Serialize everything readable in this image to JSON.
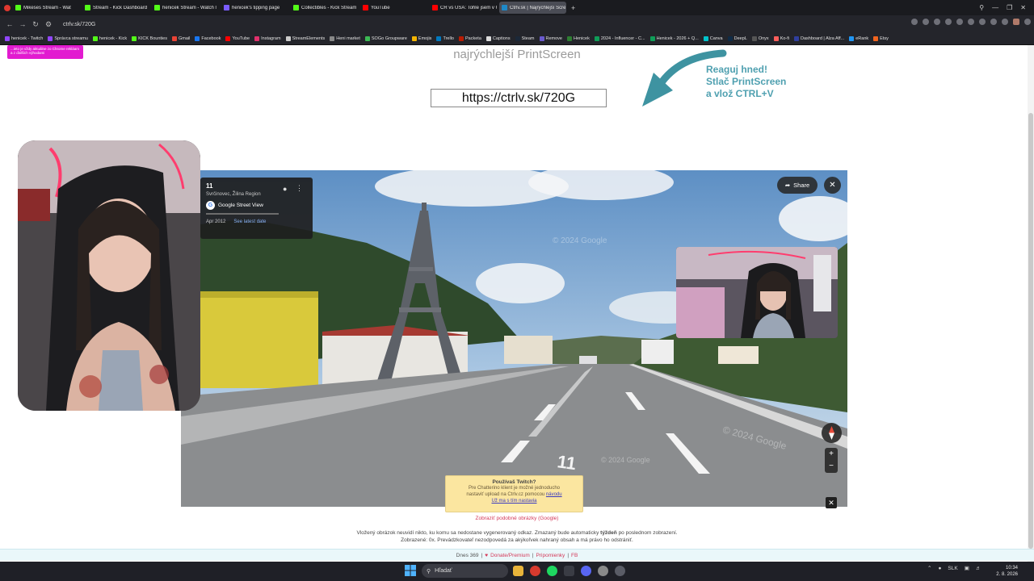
{
  "tabs": [
    {
      "label": "Mikeses Stream - Wat",
      "color": "#53fc18",
      "active": false
    },
    {
      "label": "Stream - Kick Dashboard",
      "color": "#53fc18",
      "active": false
    },
    {
      "label": "henicek Stream - Watch l",
      "color": "#53fc18",
      "active": false
    },
    {
      "label": "henicek's tipping page",
      "color": "#7a5cff",
      "active": false
    },
    {
      "label": "Collectibles - Kick Stream",
      "color": "#53fc18",
      "active": false
    },
    {
      "label": "YouTube",
      "color": "#ff0000",
      "active": false
    },
    {
      "label": "ČR vs USA: Tohle jsem v Č",
      "color": "#ff0000",
      "active": false
    },
    {
      "label": "Ctrlv.sk | Najrýchlejší Scre",
      "color": "#1e88c7",
      "active": true
    }
  ],
  "new_tab_label": "+",
  "address": "ctrlv.sk/720G",
  "bookmarks": [
    {
      "label": "henicek - Twitch",
      "color": "#9146ff"
    },
    {
      "label": "Správca streamu",
      "color": "#9146ff"
    },
    {
      "label": "henicek - Kick",
      "color": "#53fc18"
    },
    {
      "label": "KICK Bounties",
      "color": "#53fc18"
    },
    {
      "label": "Gmail",
      "color": "#ea4335"
    },
    {
      "label": "Facebook",
      "color": "#1877f2"
    },
    {
      "label": "YouTube",
      "color": "#ff0000"
    },
    {
      "label": "Instagram",
      "color": "#e1306c"
    },
    {
      "label": "StreamElements",
      "color": "#cccccc"
    },
    {
      "label": "Heni market",
      "color": "#888888"
    },
    {
      "label": "SOGo Groupware",
      "color": "#3cba54"
    },
    {
      "label": "Emojis",
      "color": "#f4b400"
    },
    {
      "label": "Trello",
      "color": "#0079bf"
    },
    {
      "label": "Packeta",
      "color": "#ba1b02"
    },
    {
      "label": "Captions",
      "color": "#dddddd"
    },
    {
      "label": "Steam",
      "color": "#1b2838"
    },
    {
      "label": "Remove",
      "color": "#6a5acd"
    },
    {
      "label": "Henicek",
      "color": "#2e7d32"
    },
    {
      "label": "2024 - Influencer - C...",
      "color": "#0f9d58"
    },
    {
      "label": "Henicek - 2026 + Q...",
      "color": "#0f9d58"
    },
    {
      "label": "Canva",
      "color": "#00c4cc"
    },
    {
      "label": "DeepL",
      "color": "#0f2b46"
    },
    {
      "label": "Onyx",
      "color": "#555555"
    },
    {
      "label": "Ko-fi",
      "color": "#ff5e5b"
    },
    {
      "label": "Dashboard | Alza Aff...",
      "color": "#2f3e9e"
    },
    {
      "label": "eRank",
      "color": "#2196f3"
    },
    {
      "label": "Etsy",
      "color": "#f1641e"
    }
  ],
  "banner_text": "...ieto je vždy aktuálne zo Chrome rekláam a z ďalších výhodami",
  "tagline": "najrýchlejší PrintScreen",
  "share_url": "https://ctrlv.sk/720G",
  "promo_text": "Reaguj hned!\nStlač PrintScreen\na vlož CTRL+V",
  "street_view": {
    "number": "11",
    "location": "Svrčinovec, Žilina Region",
    "brand": "Google Street View",
    "date": "Apr 2012",
    "latest_link": "See latest date",
    "share_label": "Share",
    "watermark": "© 2024 Google"
  },
  "twitch_notice": {
    "title": "Používaš Twitch?",
    "line1": "Pre Chatterino klient je možné jednoducho",
    "line2_prefix": "nastaviť upload na Ctrlv.cz pomocou",
    "link": "návodu",
    "line3": "Už ma s tím nastavia"
  },
  "similar_link": "Zobraziť podobné obrázky (Google)",
  "disclaimer_line1_a": "Vložený obrázok neuvidí nikto, ku komu sa nedostane vygenerovaný odkaz. Zmazaný bude automaticky",
  "disclaimer_bold": "týždeň",
  "disclaimer_line1_b": "po poslednom zobrazení.",
  "disclaimer_line2": "Zobrazené: 0x. Prevádzkovateľ nezodpovedá za akýkoľvek nahraný obsah a má právo ho odstrániť.",
  "footer": {
    "today": "Dnes 369",
    "sep": "|",
    "heart": "♥",
    "donate": "Donate/Premium",
    "pripomienky": "Pripomienky",
    "fb": "FB"
  },
  "taskbar": {
    "search_placeholder": "Hľadať",
    "lang": "SLK",
    "time": "10:34",
    "date": "2. 8. 2026"
  }
}
